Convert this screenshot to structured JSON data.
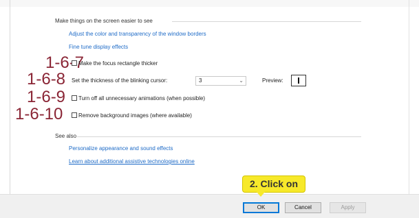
{
  "section_make_easier": {
    "heading": "Make things on the screen easier to see",
    "links": [
      "Adjust the color and transparency of the window borders",
      "Fine tune display effects"
    ]
  },
  "options": [
    {
      "step": "1-6-7",
      "label": "Make the focus rectangle thicker",
      "checked": false
    },
    {
      "step": "1-6-8",
      "label": "Set the thickness of the blinking cursor:"
    },
    {
      "step": "1-6-9",
      "label": "Turn off all unnecessary animations (when possible)",
      "checked": false
    },
    {
      "step": "1-6-10",
      "label": "Remove background images (where available)",
      "checked": false
    }
  ],
  "cursor_thickness": {
    "value": "3",
    "preview_label": "Preview:"
  },
  "section_see_also": {
    "heading": "See also",
    "links": [
      "Personalize appearance and sound effects",
      "Learn about additional assistive technologies online"
    ]
  },
  "buttons": {
    "ok": "OK",
    "cancel": "Cancel",
    "apply": "Apply"
  },
  "callout": {
    "text": "2. Click on",
    "color": "#f7e92a"
  },
  "colors": {
    "link": "#1e6bc7",
    "step_number": "#8a2535"
  }
}
